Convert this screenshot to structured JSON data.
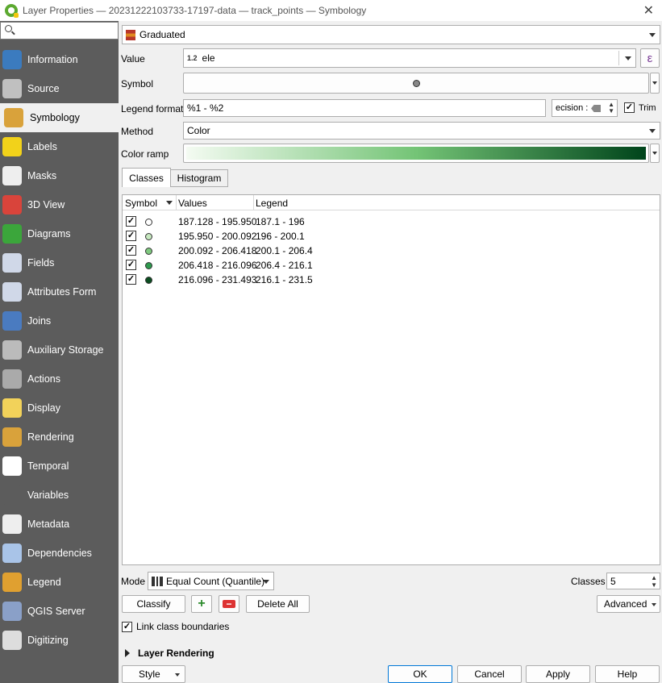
{
  "window": {
    "title": "Layer Properties — 20231222103733-17197-data — track_points — Symbology",
    "close": "✕"
  },
  "sidebar": {
    "items": [
      {
        "label": "Information",
        "icon": "info-icon",
        "color": "#3b7bbf"
      },
      {
        "label": "Source",
        "icon": "source-icon",
        "color": "#c0c0c0"
      },
      {
        "label": "Symbology",
        "icon": "paintbrush-icon",
        "color": "#d9a23b"
      },
      {
        "label": "Labels",
        "icon": "labels-icon",
        "color": "#f2d21a"
      },
      {
        "label": "Masks",
        "icon": "masks-icon",
        "color": "#eeeeee"
      },
      {
        "label": "3D View",
        "icon": "cube-icon",
        "color": "#d9443b"
      },
      {
        "label": "Diagrams",
        "icon": "diagrams-icon",
        "color": "#3ba63b"
      },
      {
        "label": "Fields",
        "icon": "fields-icon",
        "color": "#d0d8e8"
      },
      {
        "label": "Attributes Form",
        "icon": "form-icon",
        "color": "#d0d8e8"
      },
      {
        "label": "Joins",
        "icon": "joins-icon",
        "color": "#4a7bc0"
      },
      {
        "label": "Auxiliary Storage",
        "icon": "database-icon",
        "color": "#bbbbbb"
      },
      {
        "label": "Actions",
        "icon": "gear-icon",
        "color": "#aaaaaa"
      },
      {
        "label": "Display",
        "icon": "speech-bubble-icon",
        "color": "#f2d25a"
      },
      {
        "label": "Rendering",
        "icon": "brush-icon",
        "color": "#d9a23b"
      },
      {
        "label": "Temporal",
        "icon": "clock-icon",
        "color": "#ffffff"
      },
      {
        "label": "Variables",
        "icon": "epsilon-icon",
        "color": "#5c5c5c"
      },
      {
        "label": "Metadata",
        "icon": "metadata-icon",
        "color": "#eeeeee"
      },
      {
        "label": "Dependencies",
        "icon": "dependencies-icon",
        "color": "#a9c4e8"
      },
      {
        "label": "Legend",
        "icon": "legend-icon",
        "color": "#e0a030"
      },
      {
        "label": "QGIS Server",
        "icon": "server-icon",
        "color": "#8aa0c8"
      },
      {
        "label": "Digitizing",
        "icon": "digitizing-icon",
        "color": "#dddddd"
      }
    ]
  },
  "renderer": {
    "value": "Graduated",
    "icon": "graduated-icon"
  },
  "value_field": {
    "label": "Value",
    "type_badge": "1.2",
    "value": "ele",
    "expr": "ε"
  },
  "symbol_row": {
    "label": "Symbol"
  },
  "legend_format": {
    "label": "Legend format",
    "value": "%1 - %2",
    "precision": "ecision :",
    "trim_label": "Trim",
    "trim_checked": "✓"
  },
  "method": {
    "label": "Method",
    "value": "Color"
  },
  "color_ramp": {
    "label": "Color ramp",
    "start": "#f4fbf2",
    "end": "#00441b"
  },
  "tabs": [
    {
      "label": "Classes"
    },
    {
      "label": "Histogram"
    }
  ],
  "table": {
    "headers": {
      "symbol": "Symbol",
      "values": "Values",
      "legend": "Legend"
    },
    "rows": [
      {
        "check": "✓",
        "color": "#ffffff",
        "values": "187.128 - 195.950",
        "legend": "187.1 - 196"
      },
      {
        "check": "✓",
        "color": "#c6e8bf",
        "values": "195.950 - 200.092",
        "legend": "196 - 200.1"
      },
      {
        "check": "✓",
        "color": "#7fc97f",
        "values": "200.092 - 206.418",
        "legend": "200.1 - 206.4"
      },
      {
        "check": "✓",
        "color": "#2e9a4e",
        "values": "206.418 - 216.096",
        "legend": "206.4 - 216.1"
      },
      {
        "check": "✓",
        "color": "#0b4d20",
        "values": "216.096 - 231.493",
        "legend": "216.1 - 231.5"
      }
    ]
  },
  "mode": {
    "label": "Mode",
    "value": "Equal Count (Quantile)"
  },
  "classes": {
    "label": "Classes",
    "value": "5"
  },
  "buttons": {
    "classify": "Classify",
    "add": "+",
    "remove": "−",
    "delete_all": "Delete All",
    "advanced": "Advanced"
  },
  "link_boundaries": {
    "label": "Link class boundaries",
    "checked": "✓"
  },
  "layer_rendering": {
    "label": "Layer Rendering"
  },
  "footer": {
    "style": "Style",
    "ok": "OK",
    "cancel": "Cancel",
    "apply": "Apply",
    "help": "Help"
  }
}
